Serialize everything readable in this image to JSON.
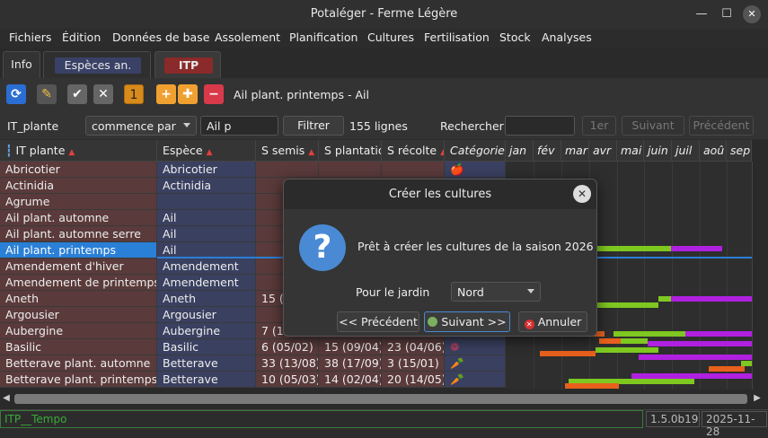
{
  "window": {
    "title": "Potaléger - Ferme Légère"
  },
  "menu": [
    "Fichiers",
    "Édition",
    "Données de base",
    "Assolement",
    "Planification",
    "Cultures",
    "Fertilisation",
    "Stock",
    "Analyses"
  ],
  "tabs": [
    "Info",
    "Espèces an.",
    "ITP"
  ],
  "toolbar": {
    "counter": "1",
    "record_label": "Ail plant. printemps - Ail"
  },
  "filter": {
    "field_label": "IT_plante",
    "mode": "commence par",
    "value": "Ail p",
    "filter_button": "Filtrer",
    "count": "155 lignes",
    "search_label": "Rechercher",
    "search_value": "",
    "first_button": "1er",
    "next_button": "Suivant",
    "prev_button": "Précédent"
  },
  "table": {
    "columns": [
      "IT plante",
      "Espèce",
      "S semis",
      "S plantation",
      "S récolte",
      "Catégories"
    ],
    "months": [
      "jan",
      "fév",
      "mar",
      "avr",
      "mai",
      "juin",
      "juil",
      "aoû",
      "sep"
    ],
    "rows": [
      [
        "Abricotier",
        "Abricotier",
        "",
        "",
        "",
        "🍎"
      ],
      [
        "Actinidia",
        "Actinidia",
        "",
        "",
        "",
        ""
      ],
      [
        "Agrume",
        "",
        "",
        "",
        "",
        ""
      ],
      [
        "Ail plant. automne",
        "Ail",
        "",
        "",
        "",
        ""
      ],
      [
        "Ail plant. automne serre",
        "Ail",
        "",
        "",
        "",
        ""
      ],
      [
        "Ail plant. printemps",
        "Ail",
        "",
        "",
        "",
        ""
      ],
      [
        "Amendement d'hiver",
        "Amendement",
        "",
        "",
        "",
        ""
      ],
      [
        "Amendement de printemps",
        "Amendement",
        "",
        "",
        "",
        ""
      ],
      [
        "Aneth",
        "Aneth",
        "15 (0",
        "",
        "",
        ""
      ],
      [
        "Argousier",
        "Argousier",
        "",
        "",
        "",
        ""
      ],
      [
        "Aubergine",
        "Aubergine",
        "7 (12",
        "",
        "",
        ""
      ],
      [
        "Basilic",
        "Basilic",
        "6 (05/02)",
        "15 (09/04)",
        "23 (04/06)",
        "❁"
      ],
      [
        "Betterave plant. automne",
        "Betterave",
        "33 (13/08)",
        "38 (17/09)",
        "3 (15/01)",
        "🥕"
      ],
      [
        "Betterave plant. printemps",
        "Betterave",
        "10 (05/03)",
        "14 (02/04)",
        "20 (14/05)",
        "🥕"
      ]
    ]
  },
  "dialog": {
    "title": "Créer les cultures",
    "message": "Prêt à créer les cultures de la saison 2026",
    "garden_label": "Pour le jardin",
    "garden_value": "Nord",
    "prev_button": "<< Précédent",
    "next_button": "Suivant >>",
    "cancel_button": "Annuler"
  },
  "status": {
    "left": "ITP__Tempo",
    "version": "1.5.0b19",
    "date": "2025-11-28"
  },
  "colors": {
    "accent": "#2a7fd6",
    "sowing": "#e8601c",
    "planting": "#7ec820",
    "harvest": "#b020e0"
  }
}
